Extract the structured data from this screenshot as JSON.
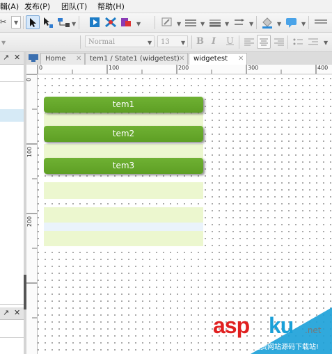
{
  "menu": {
    "items": [
      {
        "label": "輯(A)"
      },
      {
        "label": "发布(P)"
      },
      {
        "label": "团队(T)"
      },
      {
        "label": "帮助(H)"
      }
    ]
  },
  "toolbar": {
    "font_name": "Normal",
    "font_size": "13",
    "bold": "B",
    "italic": "I",
    "underline": "U"
  },
  "left_panel": {
    "pin_icon": "↗",
    "close_icon": "✕"
  },
  "tabs": [
    {
      "label": "Home",
      "active": false
    },
    {
      "label": "tem1 / State1 (widgetest)",
      "active": false
    },
    {
      "label": "widgetest",
      "active": true
    }
  ],
  "ruler": {
    "top": [
      "0",
      "100",
      "200",
      "300",
      "400"
    ],
    "left": [
      "0",
      "100",
      "200"
    ]
  },
  "canvas": {
    "buttons": [
      {
        "label": "tem1"
      },
      {
        "label": "tem2"
      },
      {
        "label": "tem3"
      }
    ]
  },
  "watermark": {
    "brand_a": "asp",
    "brand_b": "ku",
    "suffix": ".net",
    "tagline": "免费网站源码下载站!"
  },
  "colors": {
    "button_green": "#66a82b",
    "slot_green": "#ecf7cf",
    "watermark_red": "#e02020",
    "watermark_blue": "#1aa0d8"
  }
}
